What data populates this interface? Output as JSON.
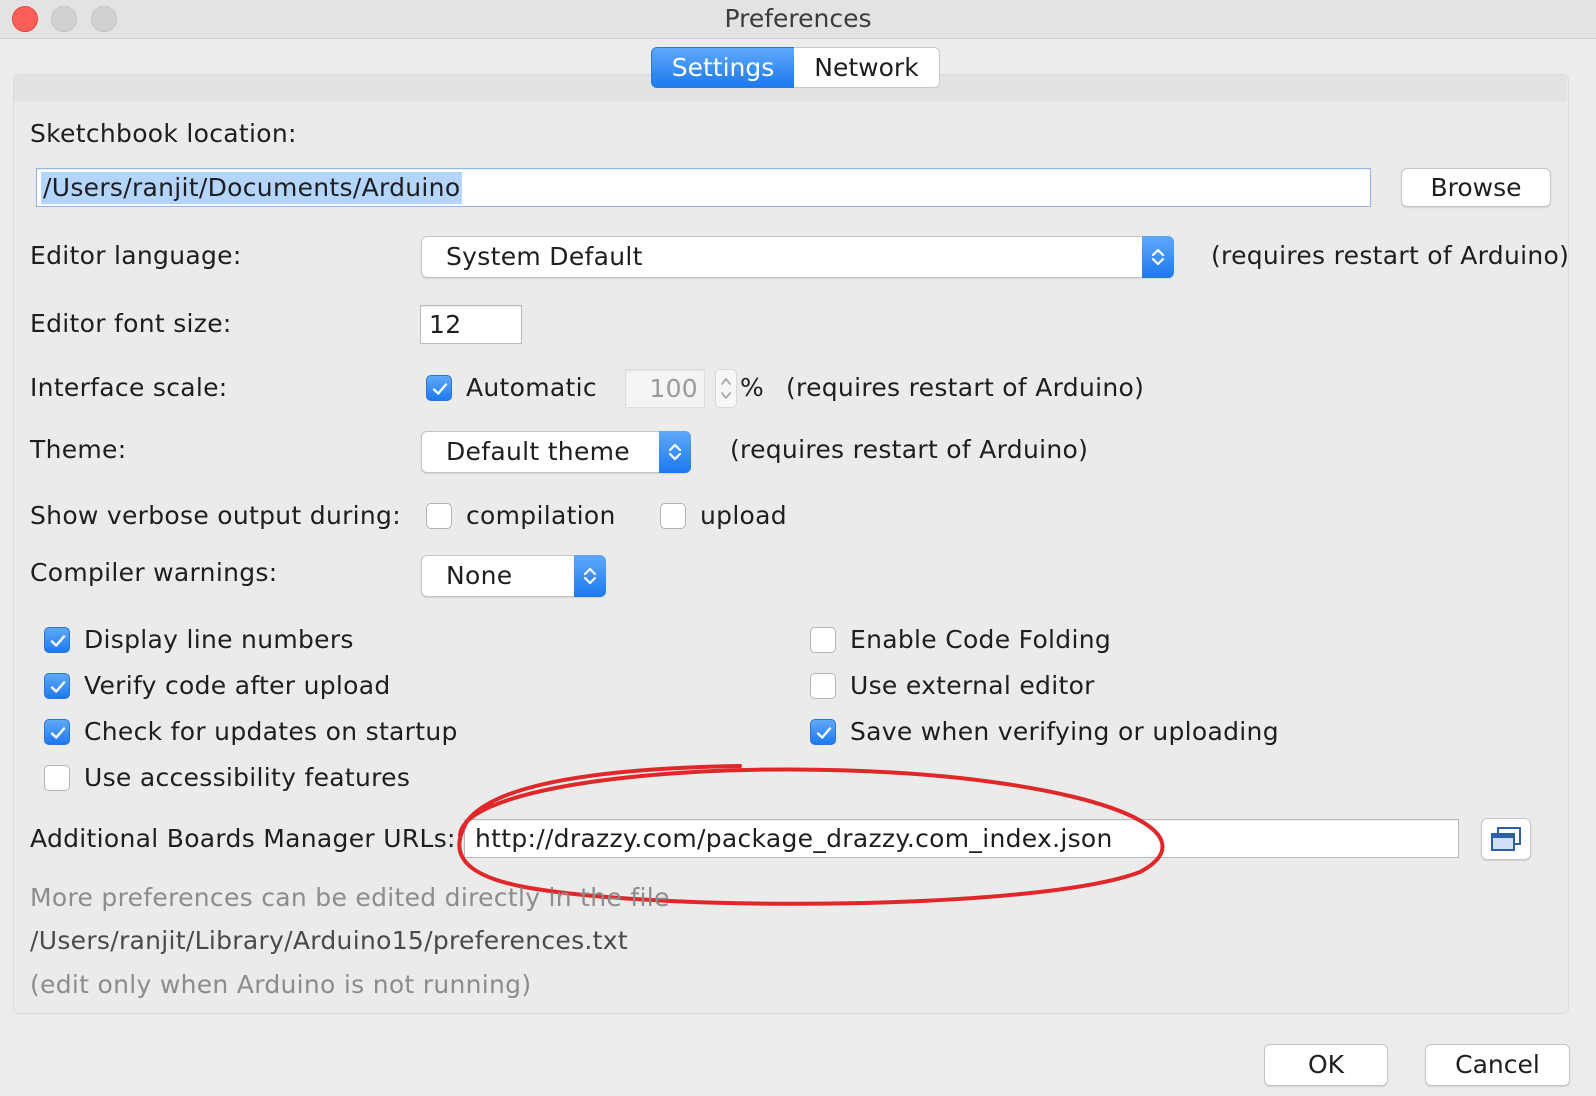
{
  "window": {
    "title": "Preferences"
  },
  "tabs": [
    {
      "label": "Settings",
      "active": true
    },
    {
      "label": "Network",
      "active": false
    }
  ],
  "sketchbook": {
    "label": "Sketchbook location:",
    "value": "/Users/ranjit/Documents/Arduino",
    "browse_label": "Browse"
  },
  "editor_language": {
    "label": "Editor language:",
    "value": "System Default",
    "note": "(requires restart of Arduino)"
  },
  "editor_font_size": {
    "label": "Editor font size:",
    "value": "12"
  },
  "interface_scale": {
    "label": "Interface scale:",
    "automatic_label": "Automatic",
    "automatic_checked": true,
    "value": "100",
    "unit": "%",
    "note": "(requires restart of Arduino)"
  },
  "theme": {
    "label": "Theme:",
    "value": "Default theme",
    "note": "(requires restart of Arduino)"
  },
  "verbose": {
    "label": "Show verbose output during:",
    "compilation_label": "compilation",
    "compilation_checked": false,
    "upload_label": "upload",
    "upload_checked": false
  },
  "compiler_warnings": {
    "label": "Compiler warnings:",
    "value": "None"
  },
  "options": {
    "display_line_numbers": {
      "label": "Display line numbers",
      "checked": true
    },
    "verify_code_after_upload": {
      "label": "Verify code after upload",
      "checked": true
    },
    "check_for_updates": {
      "label": "Check for updates on startup",
      "checked": true
    },
    "use_accessibility": {
      "label": "Use accessibility features",
      "checked": false
    },
    "enable_code_folding": {
      "label": "Enable Code Folding",
      "checked": false
    },
    "use_external_editor": {
      "label": "Use external editor",
      "checked": false
    },
    "save_when_verifying": {
      "label": "Save when verifying or uploading",
      "checked": true
    }
  },
  "boards_manager": {
    "label": "Additional Boards Manager URLs:",
    "value": "http://drazzy.com/package_drazzy.com_index.json"
  },
  "footer_notes": {
    "line1": "More preferences can be edited directly in the file",
    "line2": "/Users/ranjit/Library/Arduino15/preferences.txt",
    "line3": "(edit only when Arduino is not running)"
  },
  "buttons": {
    "ok_label": "OK",
    "cancel_label": "Cancel"
  },
  "colors": {
    "accent": "#1d79ee",
    "annotation_circle": "#e0282b",
    "selection": "#b4d5fd"
  }
}
